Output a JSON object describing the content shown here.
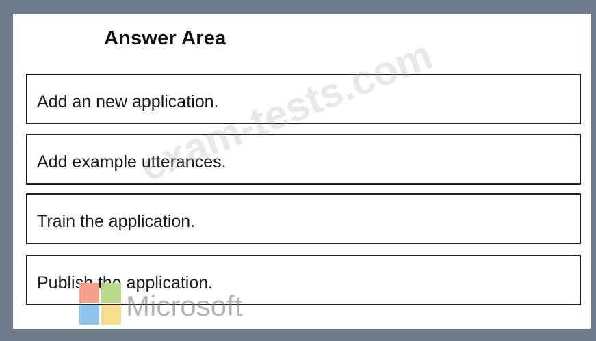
{
  "answer_area": {
    "title": "Answer Area",
    "steps": [
      "Add an new application.",
      "Add example utterances.",
      "Train the application.",
      "Publish the application."
    ]
  },
  "watermark": {
    "text": "exam-tests.com"
  },
  "branding": {
    "microsoft_text": "Microsoft",
    "logo_colors": [
      "#f4a08a",
      "#b6d98a",
      "#8fc4ec",
      "#f9dd8a"
    ]
  }
}
